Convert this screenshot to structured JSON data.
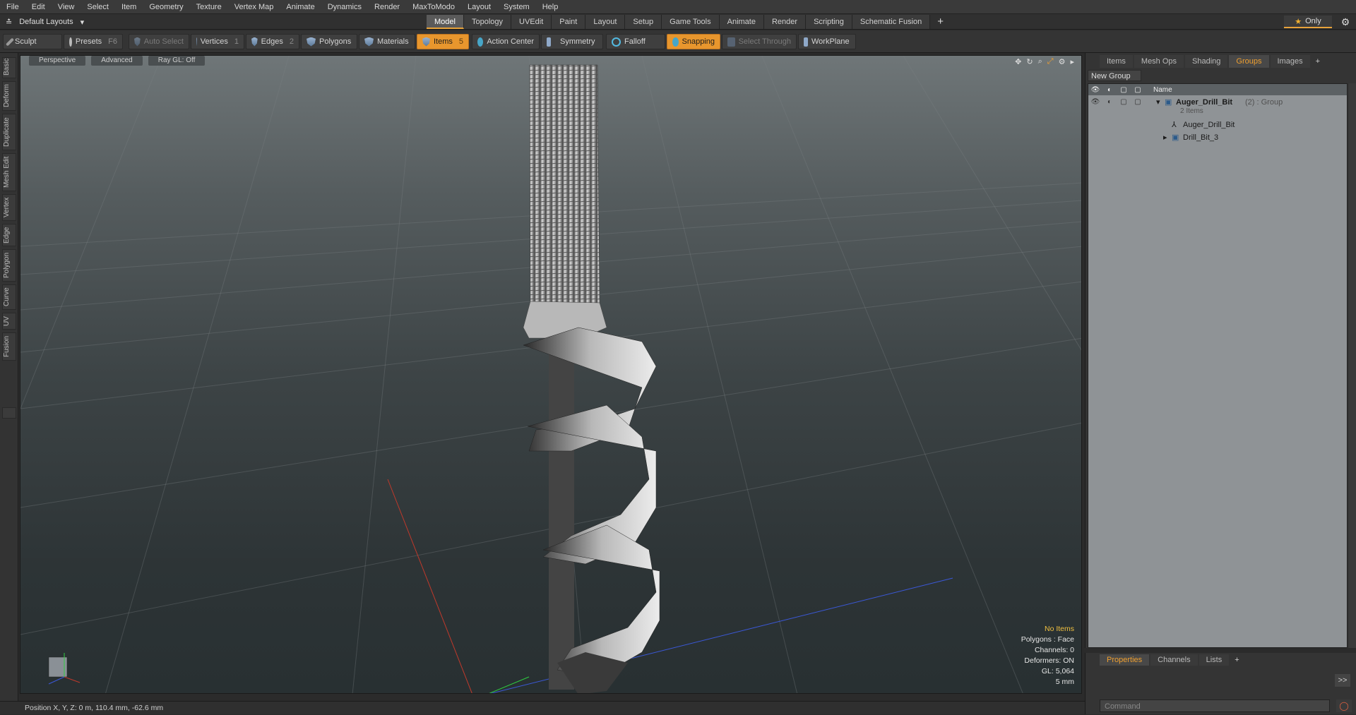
{
  "menubar": {
    "items": [
      "File",
      "Edit",
      "View",
      "Select",
      "Item",
      "Geometry",
      "Texture",
      "Vertex Map",
      "Animate",
      "Dynamics",
      "Render",
      "MaxToModo",
      "Layout",
      "System",
      "Help"
    ]
  },
  "layoutbar": {
    "layout_label": "Default Layouts",
    "tabs": [
      "Model",
      "Topology",
      "UVEdit",
      "Paint",
      "Layout",
      "Setup",
      "Game Tools",
      "Animate",
      "Render",
      "Scripting",
      "Schematic Fusion"
    ],
    "active_tab": "Model",
    "only_label": "Only"
  },
  "toolbar": {
    "sculpt": "Sculpt",
    "presets": "Presets",
    "presets_key": "F6",
    "auto_select": "Auto Select",
    "vertices": "Vertices",
    "vertices_key": "1",
    "edges": "Edges",
    "edges_key": "2",
    "polygons": "Polygons",
    "materials": "Materials",
    "items": "Items",
    "items_key": "5",
    "action_center": "Action Center",
    "symmetry": "Symmetry",
    "falloff": "Falloff",
    "snapping": "Snapping",
    "select_through": "Select Through",
    "workplane": "WorkPlane"
  },
  "lefttabs": [
    "Basic",
    "Deform",
    "Duplicate",
    "Mesh Edit",
    "Vertex",
    "Edge",
    "Polygon",
    "Curve",
    "UV",
    "Fusion"
  ],
  "viewport": {
    "header": [
      "Perspective",
      "Advanced",
      "Ray GL: Off"
    ],
    "hud": {
      "status": "No Items",
      "polygons": "Polygons : Face",
      "channels": "Channels: 0",
      "deformers": "Deformers: ON",
      "gl": "GL: 5,064",
      "scale": "5 mm"
    }
  },
  "statusbar": {
    "position": "Position X, Y, Z:   0 m, 110.4 mm, -62.6 mm"
  },
  "rightpanel": {
    "tabs": [
      "Items",
      "Mesh Ops",
      "Shading",
      "Groups",
      "Images"
    ],
    "active_tab": "Groups",
    "new_group": "New Group",
    "name_header": "Name",
    "group": {
      "name": "Auger_Drill_Bit",
      "suffix": "(2) : Group",
      "count": "2 Items"
    },
    "children": [
      "Auger_Drill_Bit",
      "Drill_Bit_3"
    ]
  },
  "lowerpanel": {
    "tabs": [
      "Properties",
      "Channels",
      "Lists"
    ],
    "active_tab": "Properties",
    "expand": ">>",
    "command_placeholder": "Command"
  }
}
